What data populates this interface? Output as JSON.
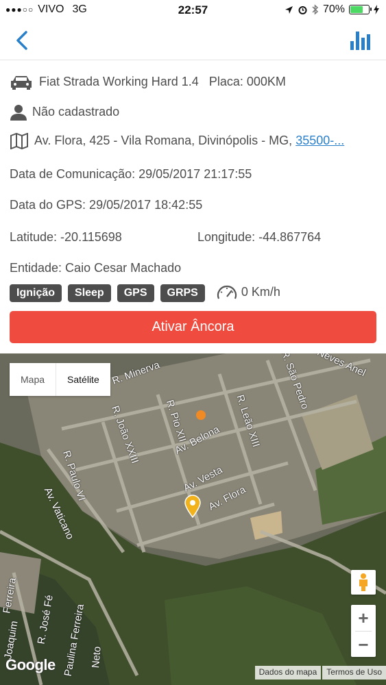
{
  "status": {
    "carrier": "VIVO",
    "network": "3G",
    "time": "22:57",
    "battery": "70%"
  },
  "vehicle": {
    "name": "Fiat Strada Working Hard 1.4",
    "plate": "Placa: 000KM",
    "owner": "Não cadastrado",
    "address": "Av. Flora, 425 - Vila Romana, Divinópolis - MG,",
    "address_link": "35500-...",
    "comm_date": "Data de Comunicação: 29/05/2017 21:17:55",
    "gps_date": "Data do GPS: 29/05/2017 18:42:55",
    "latitude": "Latitude: -20.115698",
    "longitude": "Longitude: -44.867764",
    "entity": "Entidade: Caio Cesar Machado"
  },
  "badges": [
    "Ignição",
    "Sleep",
    "GPS",
    "GRPS"
  ],
  "speed": "0 Km/h",
  "anchor_button": "Ativar Âncora",
  "map": {
    "type_map": "Mapa",
    "type_satellite": "Satélite",
    "zoom_in": "+",
    "zoom_out": "−",
    "google": "Google",
    "attrib_data": "Dados do mapa",
    "attrib_terms": "Termos de Uso",
    "streets": [
      "R. Minerva",
      "R. João XXIII",
      "R. Pio XII",
      "R. Leão XIII",
      "R. São Pedro",
      "R. Paulo VI",
      "Av. Vaticano",
      "Av. Belona",
      "Av. Vesta",
      "Av. Flora",
      "Neves Anel",
      "R. José Fé",
      "Joaquim",
      "Ferreira",
      "Paulina Ferreira",
      "Neto"
    ]
  },
  "colors": {
    "accent": "#2a7fc9",
    "danger": "#ef4b3e",
    "badge": "#4d4d4d",
    "pin": "#f2b21b"
  }
}
